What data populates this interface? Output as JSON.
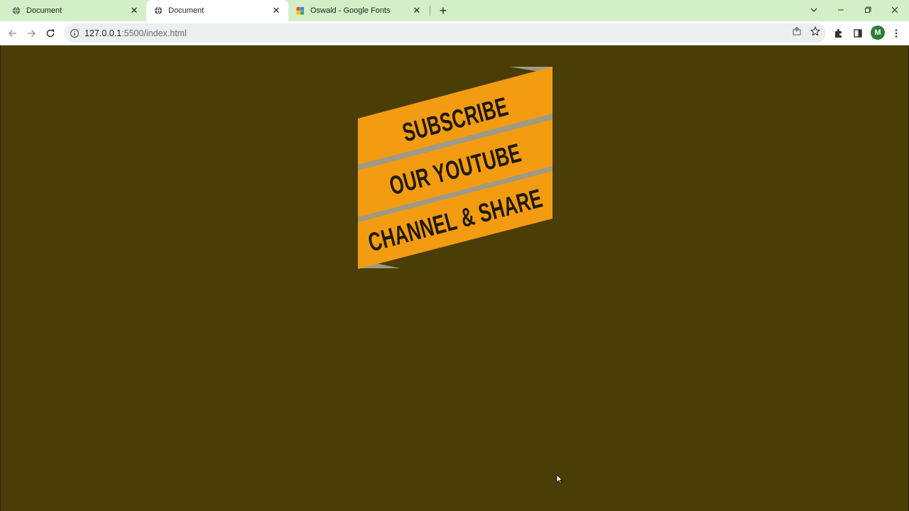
{
  "tabs": [
    {
      "title": "Document",
      "favicon": "globe-icon"
    },
    {
      "title": "Document",
      "favicon": "globe-icon",
      "active": true
    },
    {
      "title": "Oswald - Google Fonts",
      "favicon": "google-fonts-icon"
    }
  ],
  "address_bar": {
    "host": "127.0.0.1",
    "rest": ":5500/index.html"
  },
  "profile": {
    "initial": "M"
  },
  "page": {
    "background": "#4a3d06",
    "ribbon": {
      "color": "#f39c12",
      "fold_color": "#9e9a86",
      "lines": [
        "SUBSCRIBE",
        "OUR YOUTUBE",
        "CHANNEL & SHARE"
      ]
    }
  }
}
